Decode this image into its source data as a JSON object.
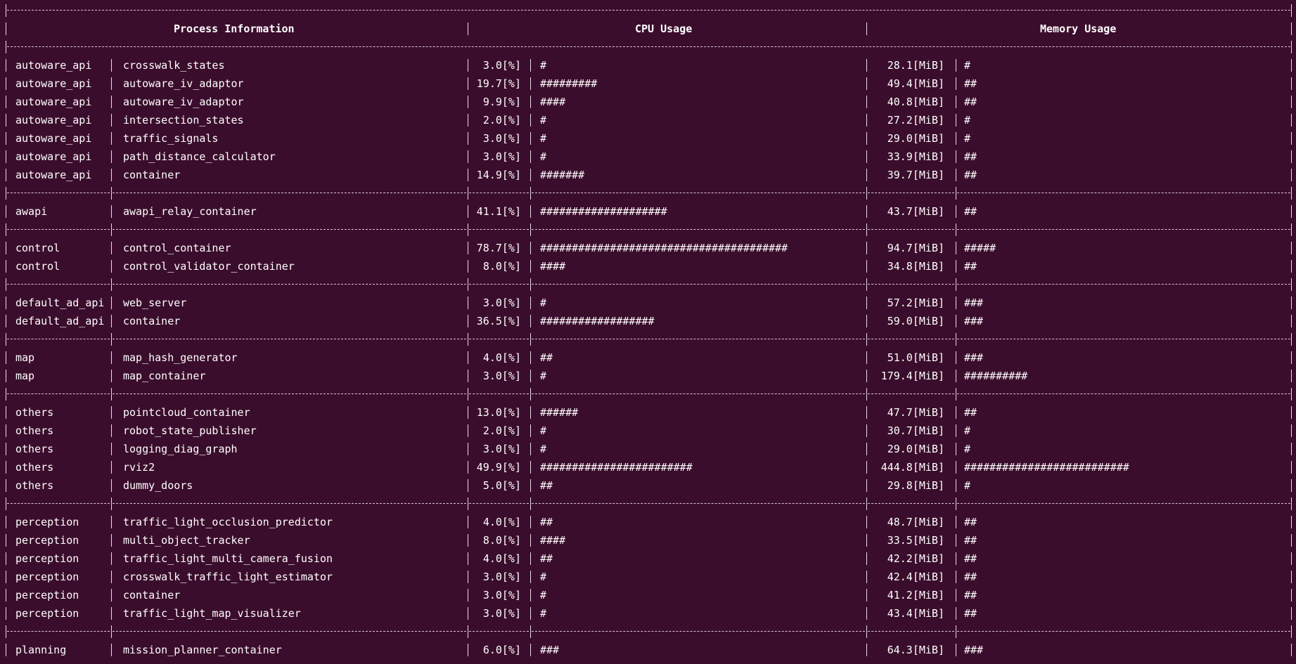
{
  "header": {
    "process_information": "Process Information",
    "cpu_usage": "CPU Usage",
    "memory_usage": "Memory Usage"
  },
  "rows": [
    {
      "type": "sep_full"
    },
    {
      "type": "header"
    },
    {
      "type": "sep_full"
    },
    {
      "type": "data",
      "group": "autoware_api",
      "name": "crosswalk_states",
      "cpu": "3.0[%]",
      "cpu_bar": "#",
      "mem": "28.1[MiB]",
      "mem_bar": "#"
    },
    {
      "type": "data",
      "group": "autoware_api",
      "name": "autoware_iv_adaptor",
      "cpu": "19.7[%]",
      "cpu_bar": "#########",
      "mem": "49.4[MiB]",
      "mem_bar": "##"
    },
    {
      "type": "data",
      "group": "autoware_api",
      "name": "autoware_iv_adaptor",
      "cpu": "9.9[%]",
      "cpu_bar": "####",
      "mem": "40.8[MiB]",
      "mem_bar": "##"
    },
    {
      "type": "data",
      "group": "autoware_api",
      "name": "intersection_states",
      "cpu": "2.0[%]",
      "cpu_bar": "#",
      "mem": "27.2[MiB]",
      "mem_bar": "#"
    },
    {
      "type": "data",
      "group": "autoware_api",
      "name": "traffic_signals",
      "cpu": "3.0[%]",
      "cpu_bar": "#",
      "mem": "29.0[MiB]",
      "mem_bar": "#"
    },
    {
      "type": "data",
      "group": "autoware_api",
      "name": "path_distance_calculator",
      "cpu": "3.0[%]",
      "cpu_bar": "#",
      "mem": "33.9[MiB]",
      "mem_bar": "##"
    },
    {
      "type": "data",
      "group": "autoware_api",
      "name": "container",
      "cpu": "14.9[%]",
      "cpu_bar": "#######",
      "mem": "39.7[MiB]",
      "mem_bar": "##"
    },
    {
      "type": "sep_cols"
    },
    {
      "type": "data",
      "group": "awapi",
      "name": "awapi_relay_container",
      "cpu": "41.1[%]",
      "cpu_bar": "####################",
      "mem": "43.7[MiB]",
      "mem_bar": "##"
    },
    {
      "type": "sep_cols"
    },
    {
      "type": "data",
      "group": "control",
      "name": "control_container",
      "cpu": "78.7[%]",
      "cpu_bar": "#######################################",
      "mem": "94.7[MiB]",
      "mem_bar": "#####"
    },
    {
      "type": "data",
      "group": "control",
      "name": "control_validator_container",
      "cpu": "8.0[%]",
      "cpu_bar": "####",
      "mem": "34.8[MiB]",
      "mem_bar": "##"
    },
    {
      "type": "sep_cols"
    },
    {
      "type": "data",
      "group": "default_ad_api",
      "name": "web_server",
      "cpu": "3.0[%]",
      "cpu_bar": "#",
      "mem": "57.2[MiB]",
      "mem_bar": "###"
    },
    {
      "type": "data",
      "group": "default_ad_api",
      "name": "container",
      "cpu": "36.5[%]",
      "cpu_bar": "##################",
      "mem": "59.0[MiB]",
      "mem_bar": "###"
    },
    {
      "type": "sep_cols"
    },
    {
      "type": "data",
      "group": "map",
      "name": "map_hash_generator",
      "cpu": "4.0[%]",
      "cpu_bar": "##",
      "mem": "51.0[MiB]",
      "mem_bar": "###"
    },
    {
      "type": "data",
      "group": "map",
      "name": "map_container",
      "cpu": "3.0[%]",
      "cpu_bar": "#",
      "mem": "179.4[MiB]",
      "mem_bar": "##########"
    },
    {
      "type": "sep_cols"
    },
    {
      "type": "data",
      "group": "others",
      "name": "pointcloud_container",
      "cpu": "13.0[%]",
      "cpu_bar": "######",
      "mem": "47.7[MiB]",
      "mem_bar": "##"
    },
    {
      "type": "data",
      "group": "others",
      "name": "robot_state_publisher",
      "cpu": "2.0[%]",
      "cpu_bar": "#",
      "mem": "30.7[MiB]",
      "mem_bar": "#"
    },
    {
      "type": "data",
      "group": "others",
      "name": "logging_diag_graph",
      "cpu": "3.0[%]",
      "cpu_bar": "#",
      "mem": "29.0[MiB]",
      "mem_bar": "#"
    },
    {
      "type": "data",
      "group": "others",
      "name": "rviz2",
      "cpu": "49.9[%]",
      "cpu_bar": "########################",
      "mem": "444.8[MiB]",
      "mem_bar": "##########################"
    },
    {
      "type": "data",
      "group": "others",
      "name": "dummy_doors",
      "cpu": "5.0[%]",
      "cpu_bar": "##",
      "mem": "29.8[MiB]",
      "mem_bar": "#"
    },
    {
      "type": "sep_cols"
    },
    {
      "type": "data",
      "group": "perception",
      "name": "traffic_light_occlusion_predictor",
      "cpu": "4.0[%]",
      "cpu_bar": "##",
      "mem": "48.7[MiB]",
      "mem_bar": "##"
    },
    {
      "type": "data",
      "group": "perception",
      "name": "multi_object_tracker",
      "cpu": "8.0[%]",
      "cpu_bar": "####",
      "mem": "33.5[MiB]",
      "mem_bar": "##"
    },
    {
      "type": "data",
      "group": "perception",
      "name": "traffic_light_multi_camera_fusion",
      "cpu": "4.0[%]",
      "cpu_bar": "##",
      "mem": "42.2[MiB]",
      "mem_bar": "##"
    },
    {
      "type": "data",
      "group": "perception",
      "name": "crosswalk_traffic_light_estimator",
      "cpu": "3.0[%]",
      "cpu_bar": "#",
      "mem": "42.4[MiB]",
      "mem_bar": "##"
    },
    {
      "type": "data",
      "group": "perception",
      "name": "container",
      "cpu": "3.0[%]",
      "cpu_bar": "#",
      "mem": "41.2[MiB]",
      "mem_bar": "##"
    },
    {
      "type": "data",
      "group": "perception",
      "name": "traffic_light_map_visualizer",
      "cpu": "3.0[%]",
      "cpu_bar": "#",
      "mem": "43.4[MiB]",
      "mem_bar": "##"
    },
    {
      "type": "sep_cols"
    },
    {
      "type": "data",
      "group": "planning",
      "name": "mission_planner_container",
      "cpu": "6.0[%]",
      "cpu_bar": "###",
      "mem": "64.3[MiB]",
      "mem_bar": "###"
    }
  ]
}
